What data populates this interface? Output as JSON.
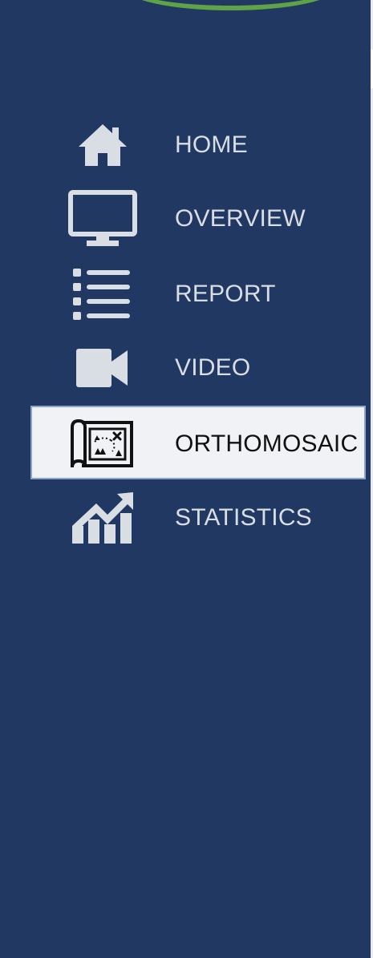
{
  "nav": {
    "items": [
      {
        "label": "HOME",
        "icon": "home-icon",
        "active": false
      },
      {
        "label": "OVERVIEW",
        "icon": "monitor-icon",
        "active": false
      },
      {
        "label": "REPORT",
        "icon": "list-icon",
        "active": false
      },
      {
        "label": "VIDEO",
        "icon": "video-camera-icon",
        "active": false
      },
      {
        "label": "ORTHOMOSAIC",
        "icon": "map-icon",
        "active": true
      },
      {
        "label": "STATISTICS",
        "icon": "chart-growth-icon",
        "active": false
      }
    ]
  },
  "colors": {
    "sidebar_bg": "#213863",
    "icon": "#d9dde4",
    "text": "#d9dde4",
    "active_bg": "#f1f2f5",
    "active_text": "#111111",
    "logo_green": "#5ea447"
  }
}
